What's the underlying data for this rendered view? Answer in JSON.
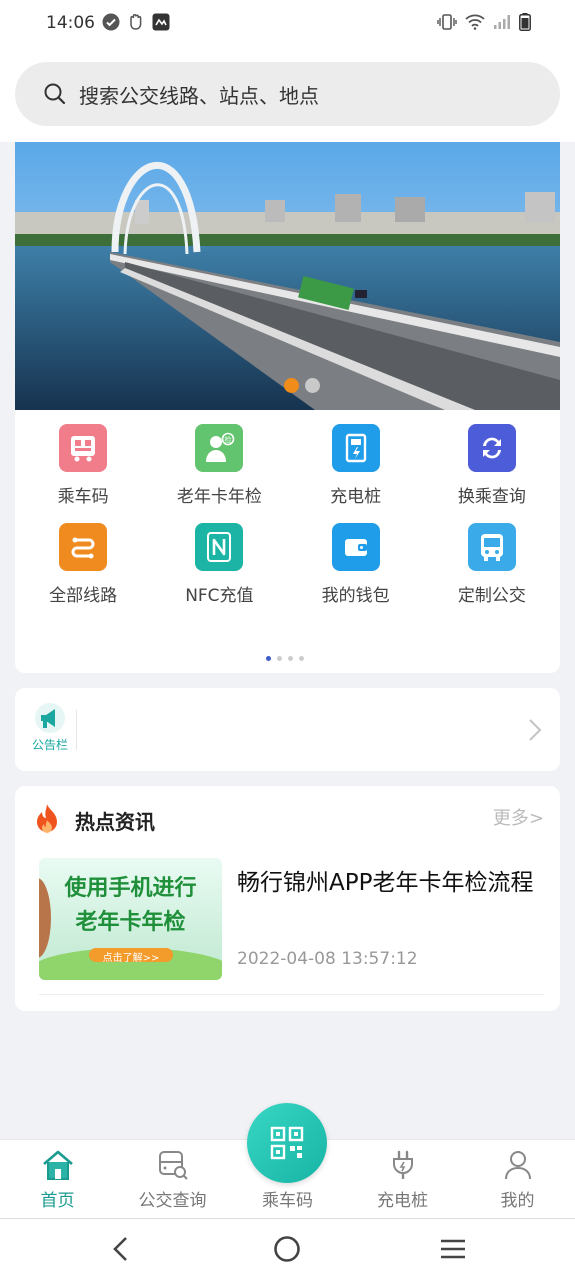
{
  "status_bar": {
    "time": "14:06"
  },
  "search": {
    "placeholder": "搜索公交线路、站点、地点"
  },
  "banner": {
    "dots": 2,
    "active_dot": 0
  },
  "grid": {
    "items": [
      {
        "label": "乘车码",
        "icon": "bus-qr-icon",
        "color": "#f06a7a"
      },
      {
        "label": "老年卡年检",
        "icon": "elderly-card-icon",
        "color": "#5fbf6a"
      },
      {
        "label": "充电桩",
        "icon": "charging-pile-icon",
        "color": "#1e9be8"
      },
      {
        "label": "换乘查询",
        "icon": "transfer-icon",
        "color": "#4b5bd6"
      },
      {
        "label": "全部线路",
        "icon": "all-routes-icon",
        "color": "#ee8a1e"
      },
      {
        "label": "NFC充值",
        "icon": "nfc-icon",
        "color": "#1bb3a3"
      },
      {
        "label": "我的钱包",
        "icon": "wallet-icon",
        "color": "#1e9be8"
      },
      {
        "label": "定制公交",
        "icon": "custom-bus-icon",
        "color": "#39a9e8"
      }
    ]
  },
  "notice": {
    "label": "公告栏"
  },
  "news": {
    "title": "热点资讯",
    "more": "更多>",
    "article": {
      "title": "畅行锦州APP老年卡年检流程",
      "date": "2022-04-08 13:57:12",
      "thumb_line1": "使用手机进行",
      "thumb_line2": "老年卡年检",
      "thumb_button": "点击了解>>"
    }
  },
  "tabbar": {
    "tabs": [
      {
        "label": "首页",
        "icon": "home-icon"
      },
      {
        "label": "公交查询",
        "icon": "bus-search-icon"
      },
      {
        "label": "乘车码",
        "icon": "qr-code-icon"
      },
      {
        "label": "充电桩",
        "icon": "plug-icon"
      },
      {
        "label": "我的",
        "icon": "user-icon"
      }
    ],
    "accent": "#1a9b8f"
  }
}
